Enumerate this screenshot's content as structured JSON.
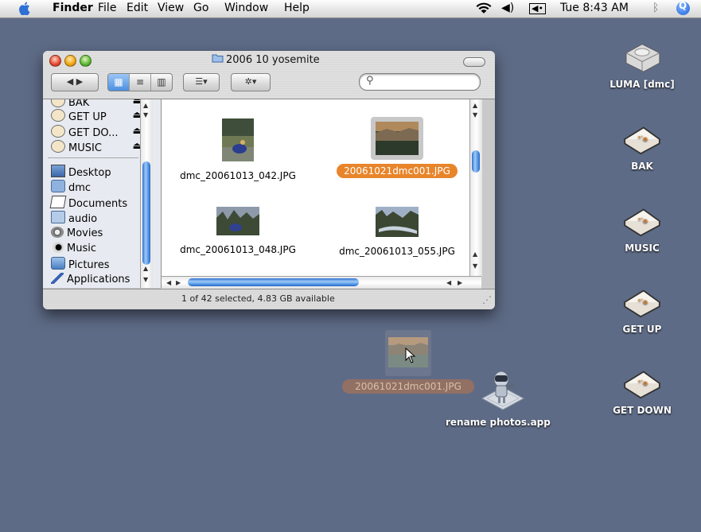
{
  "menubar": {
    "app_name": "Finder",
    "menus": [
      "File",
      "Edit",
      "View",
      "Go",
      "Window",
      "Help"
    ],
    "clock": "Tue 8:43 AM",
    "icons": [
      "apple-icon",
      "wifi-icon",
      "volume-icon",
      "battery-icon",
      "bluetooth-icon",
      "spotlight-icon"
    ]
  },
  "window": {
    "title": "2006 10 yosemite",
    "status": "1 of 42 selected, 4.83 GB available"
  },
  "toolbar": {
    "search_placeholder": "",
    "back_forward": "◀ ▶",
    "view_icons": "▦",
    "view_list": "≡",
    "view_columns": "▥",
    "arrange": "☰▾",
    "action": "✲▾"
  },
  "sidebar": {
    "devices": [
      {
        "label": "BAK",
        "icon": "drive-icon",
        "eject": true
      },
      {
        "label": "GET UP",
        "icon": "drive-icon",
        "eject": true
      },
      {
        "label": "GET DO...",
        "icon": "drive-icon",
        "eject": true
      },
      {
        "label": "MUSIC",
        "icon": "drive-icon",
        "eject": true
      }
    ],
    "places": [
      {
        "label": "Desktop",
        "icon": "desktop-icon"
      },
      {
        "label": "dmc",
        "icon": "home-icon"
      },
      {
        "label": "Documents",
        "icon": "documents-icon"
      },
      {
        "label": "audio",
        "icon": "folder-icon"
      },
      {
        "label": "Movies",
        "icon": "movies-icon"
      },
      {
        "label": "Music",
        "icon": "music-icon"
      },
      {
        "label": "Pictures",
        "icon": "pictures-icon"
      },
      {
        "label": "Applications",
        "icon": "applications-icon"
      }
    ]
  },
  "files": [
    {
      "name": "dmc_20061013_042.JPG",
      "selected": false
    },
    {
      "name": "20061021dmc001.JPG",
      "selected": true
    },
    {
      "name": "dmc_20061013_048.JPG",
      "selected": false
    },
    {
      "name": "dmc_20061013_055.JPG",
      "selected": false
    }
  ],
  "desktop": {
    "icons": [
      {
        "label": "LUMA [dmc]",
        "icon": "hard-drive-icon"
      },
      {
        "label": "BAK",
        "icon": "external-drive-icon"
      },
      {
        "label": "MUSIC",
        "icon": "external-drive-icon"
      },
      {
        "label": "GET UP",
        "icon": "external-drive-icon"
      },
      {
        "label": "GET DOWN",
        "icon": "external-drive-icon"
      }
    ],
    "dragging_file": "20061021dmc001.JPG",
    "app": "rename photos.app"
  },
  "colors": {
    "desktop": "#5e6b86",
    "selection": "#e8852b",
    "scroll_blue": "#4b8fe0"
  }
}
